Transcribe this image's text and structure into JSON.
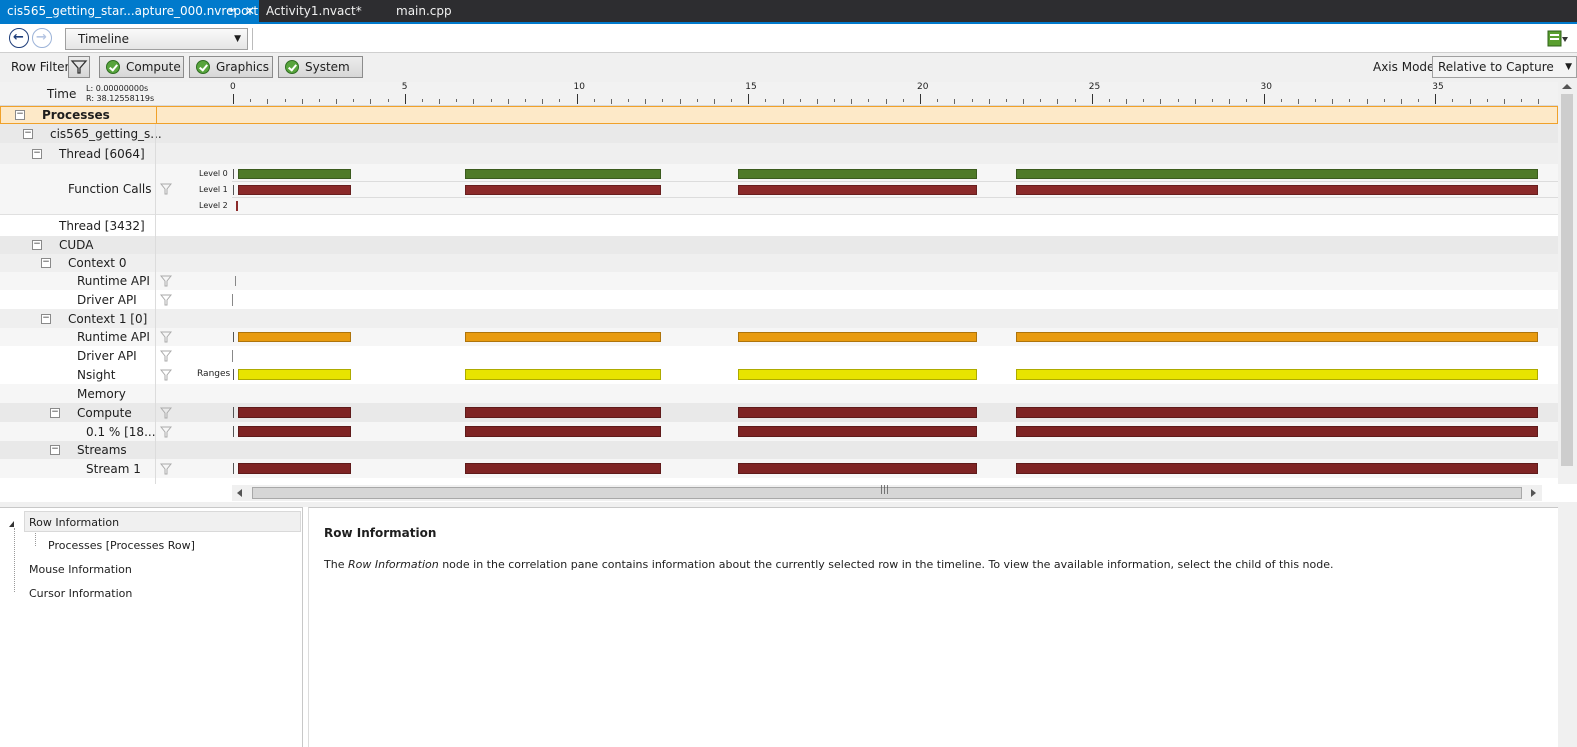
{
  "tabs": [
    {
      "label": "cis565_getting_star...apture_000.nvreport",
      "active": true,
      "pin": "⇸",
      "close": "✕"
    },
    {
      "label": "Activity1.nvact*",
      "active": false
    },
    {
      "label": "main.cpp",
      "active": false
    }
  ],
  "toolbar": {
    "back_icon": "arrow-left-icon",
    "forward_icon": "arrow-right-icon",
    "view_select": "Timeline"
  },
  "filters": {
    "label": "Row Filters",
    "buttons": [
      "Compute",
      "Graphics",
      "System"
    ],
    "axis_mode_label": "Axis Mode:",
    "axis_mode_value": "Relative to Capture"
  },
  "time_header": {
    "label": "Time",
    "left": "L: 0.00000000s",
    "right": "R: 38.12558119s",
    "ticks": [
      "0",
      "5",
      "10",
      "15",
      "20",
      "25",
      "30",
      "35"
    ]
  },
  "rows": [
    {
      "label": "Processes",
      "bold": true
    },
    {
      "label": "cis565_getting_s..."
    },
    {
      "label": "Thread [6064]"
    },
    {
      "label": "Function Calls",
      "levels": [
        "Level 0",
        "Level 1",
        "Level 2"
      ]
    },
    {
      "label": "Thread [3432]"
    },
    {
      "label": "CUDA"
    },
    {
      "label": "Context 0"
    },
    {
      "label": "Runtime API"
    },
    {
      "label": "Driver API"
    },
    {
      "label": "Context 1 [0]"
    },
    {
      "label": "Runtime API"
    },
    {
      "label": "Driver API"
    },
    {
      "label": "Nsight",
      "sublabel": "Ranges"
    },
    {
      "label": "Memory"
    },
    {
      "label": "Compute"
    },
    {
      "label": "0.1 % [18..."
    },
    {
      "label": "Streams"
    },
    {
      "label": "Stream 1"
    }
  ],
  "timeline": {
    "range_s": [
      0,
      38.12558119
    ],
    "segments": [
      [
        0.15,
        3.45
      ],
      [
        6.75,
        12.45
      ],
      [
        14.7,
        21.65
      ],
      [
        22.8,
        38.0
      ]
    ],
    "colors": {
      "level0": "#4f7a28",
      "function": "#8b2a2a",
      "runtime": "#e89b10",
      "nsight": "#e8e400",
      "kernel": "#7f2424"
    }
  },
  "tree": {
    "items": [
      "Row Information",
      "Processes [Processes Row]",
      "Mouse Information",
      "Cursor Information"
    ]
  },
  "info": {
    "title": "Row Information",
    "text_prefix": "The ",
    "text_italic": "Row Information",
    "text_suffix": " node in the correlation pane contains information about the currently selected row in the timeline. To view the available information, select the child of this node."
  }
}
